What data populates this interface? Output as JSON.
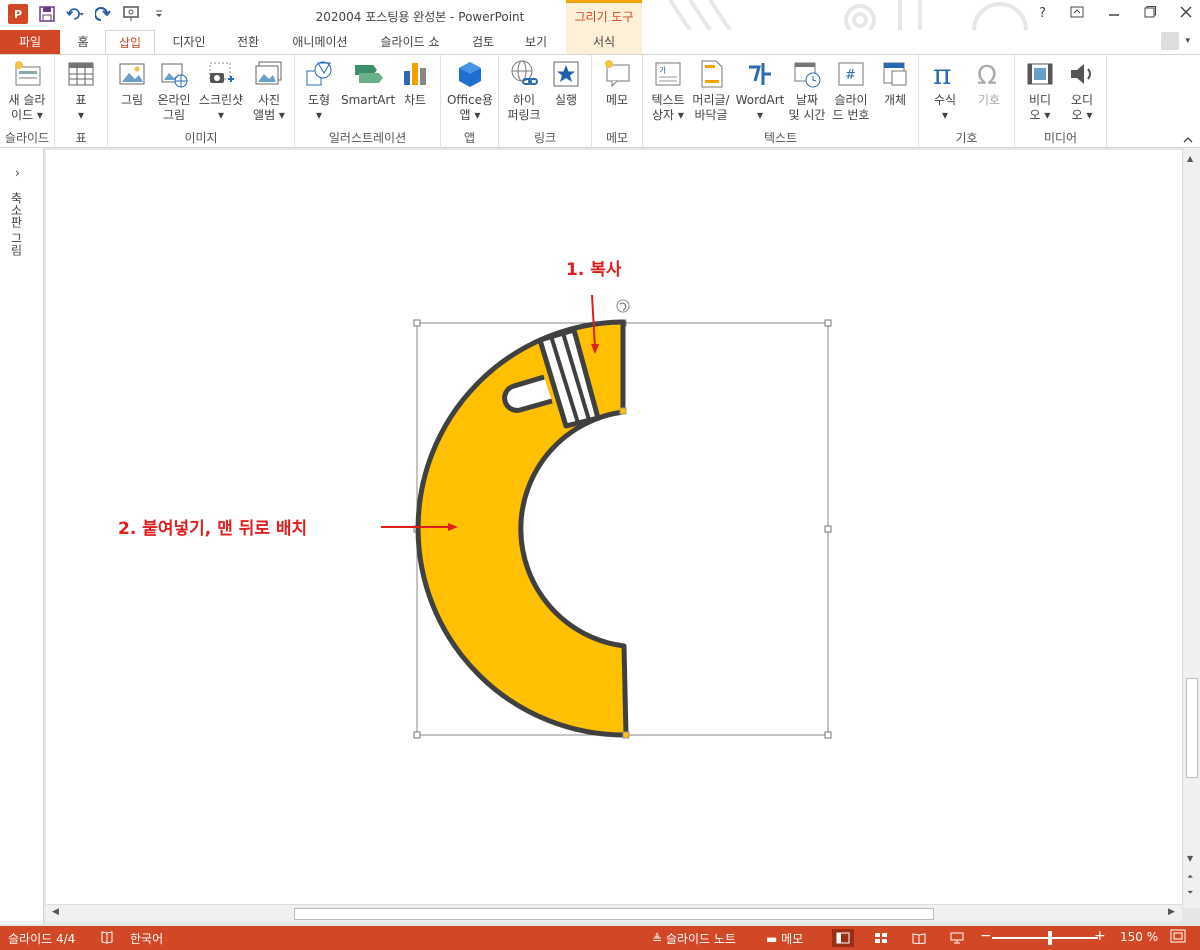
{
  "window": {
    "title": "202004 포스팅용 완성본 - PowerPoint",
    "contextual_group": "그리기 도구",
    "app_badge": "P"
  },
  "tabs": [
    {
      "label": "파일"
    },
    {
      "label": "홈"
    },
    {
      "label": "삽입"
    },
    {
      "label": "디자인"
    },
    {
      "label": "전환"
    },
    {
      "label": "애니메이션"
    },
    {
      "label": "슬라이드 쇼"
    },
    {
      "label": "검토"
    },
    {
      "label": "보기"
    },
    {
      "label": "서식"
    }
  ],
  "ribbon": {
    "groups": {
      "slides": "슬라이드",
      "table": "표",
      "images": "이미지",
      "illustrations": "일러스트레이션",
      "apps": "앱",
      "links": "링크",
      "comments": "메모",
      "text": "텍스트",
      "symbols": "기호",
      "media": "미디어"
    },
    "buttons": {
      "new_slide": "새 슬라\n이드 ▾",
      "table": "표\n▾",
      "picture": "그림",
      "online_picture": "온라인\n그림",
      "screenshot": "스크린샷\n▾",
      "photo_album": "사진\n앨범 ▾",
      "shapes": "도형\n▾",
      "smartart": "SmartArt",
      "chart": "차트",
      "office_apps": "Office용\n앱 ▾",
      "hyperlink": "하이\n퍼링크",
      "action": "실행",
      "comment": "메모",
      "textbox": "텍스트\n상자 ▾",
      "header_footer": "머리글/\n바닥글",
      "wordart": "WordArt\n▾",
      "date_time": "날짜\n및 시간",
      "slide_number": "슬라이\n드 번호",
      "object": "개체",
      "equation": "수식\n▾",
      "symbol": "기호",
      "video": "비디\n오 ▾",
      "audio": "오디\n오 ▾"
    }
  },
  "thumbnail_pane": {
    "label": "축소판 그림"
  },
  "slide": {
    "annotations": {
      "copy": "1. 복사",
      "paste": "2. 붙여넣기, 맨 뒤로 배치"
    },
    "colors": {
      "shape_fill": "#FFC000",
      "shape_stroke": "#404040",
      "annotation": "#E01E1E"
    }
  },
  "statusbar": {
    "slide_info": "슬라이드 4/4",
    "language": "한국어",
    "notes": "슬라이드 노트",
    "comments": "메모",
    "zoom": "150 %"
  }
}
